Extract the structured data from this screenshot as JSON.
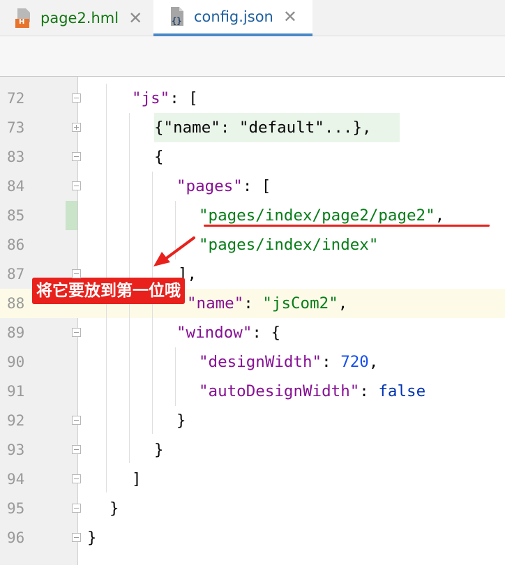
{
  "tabs": [
    {
      "label": "page2.hml",
      "icon": "hml-file-icon",
      "icon_text": "H",
      "color": "#117711"
    },
    {
      "label": "config.json",
      "icon": "json-file-icon",
      "icon_text": "{}",
      "color": "#1d5f9e"
    }
  ],
  "close_glyph": "✕",
  "editor": {
    "lines": [
      {
        "num": "72",
        "tokens": [
          {
            "t": "\"js\"",
            "c": "k"
          },
          {
            "t": ": [",
            "c": "p"
          }
        ]
      },
      {
        "num": "73",
        "tokens": [
          {
            "t": "{\"name\": \"default\"...}",
            "c": "p"
          },
          {
            "t": ",",
            "c": "p"
          }
        ]
      },
      {
        "num": "83",
        "tokens": [
          {
            "t": "{",
            "c": "p"
          }
        ]
      },
      {
        "num": "84",
        "tokens": [
          {
            "t": "\"pages\"",
            "c": "k"
          },
          {
            "t": ": [",
            "c": "p"
          }
        ]
      },
      {
        "num": "85",
        "tokens": [
          {
            "t": "\"pages/index/page2/page2\"",
            "c": "s"
          },
          {
            "t": ",",
            "c": "p"
          }
        ]
      },
      {
        "num": "86",
        "tokens": [
          {
            "t": "\"pages/index/index\"",
            "c": "s"
          }
        ]
      },
      {
        "num": "87",
        "tokens": [
          {
            "t": "],",
            "c": "p"
          }
        ]
      },
      {
        "num": "88",
        "tokens": [
          {
            "t": "\"name\"",
            "c": "k"
          },
          {
            "t": ": ",
            "c": "p"
          },
          {
            "t": "\"jsCom2\"",
            "c": "s"
          },
          {
            "t": ",",
            "c": "p"
          }
        ]
      },
      {
        "num": "89",
        "tokens": [
          {
            "t": "\"window\"",
            "c": "k"
          },
          {
            "t": ": {",
            "c": "p"
          }
        ]
      },
      {
        "num": "90",
        "tokens": [
          {
            "t": "\"designWidth\"",
            "c": "k"
          },
          {
            "t": ": ",
            "c": "p"
          },
          {
            "t": "720",
            "c": "n"
          },
          {
            "t": ",",
            "c": "p"
          }
        ]
      },
      {
        "num": "91",
        "tokens": [
          {
            "t": "\"autoDesignWidth\"",
            "c": "k"
          },
          {
            "t": ": ",
            "c": "p"
          },
          {
            "t": "false",
            "c": "b"
          }
        ]
      },
      {
        "num": "92",
        "tokens": [
          {
            "t": "}",
            "c": "p"
          }
        ]
      },
      {
        "num": "93",
        "tokens": [
          {
            "t": "}",
            "c": "p"
          }
        ]
      },
      {
        "num": "94",
        "tokens": [
          {
            "t": "]",
            "c": "p"
          }
        ]
      },
      {
        "num": "95",
        "tokens": [
          {
            "t": "}",
            "c": "p"
          }
        ]
      },
      {
        "num": "96",
        "tokens": [
          {
            "t": "}",
            "c": "p"
          }
        ]
      }
    ]
  },
  "annotation": {
    "text": "将它要放到第一位哦",
    "color": "#e8211c"
  }
}
